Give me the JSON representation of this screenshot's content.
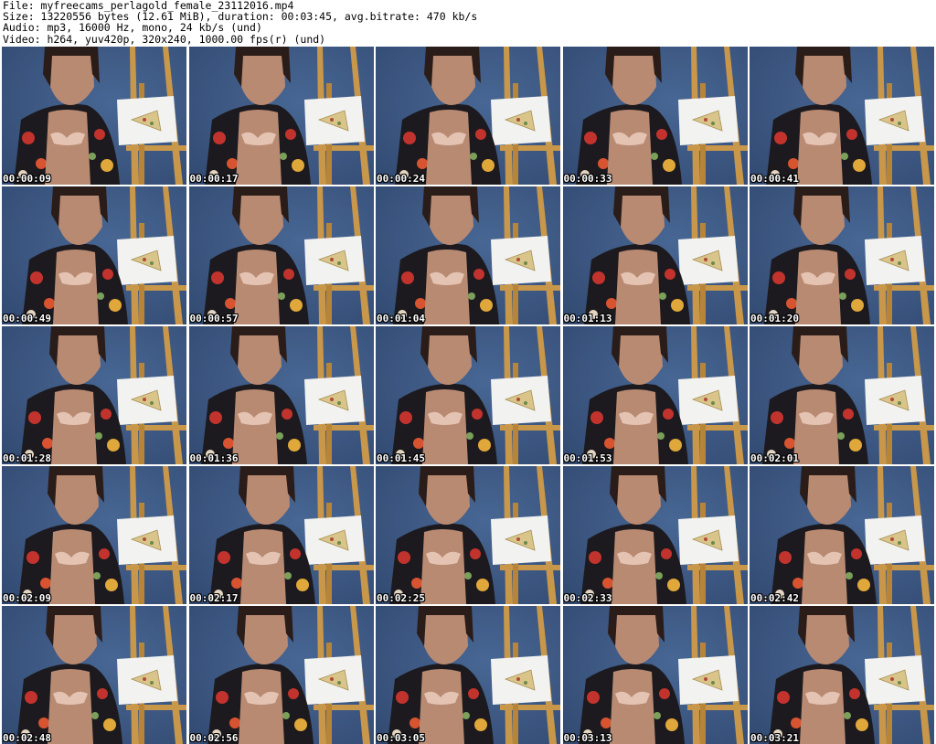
{
  "info": {
    "file": "File: myfreecams_perlagold_female_23112016.mp4",
    "size": "Size: 13220556 bytes (12.61 MiB), duration: 00:03:45, avg.bitrate: 470 kb/s",
    "audio": "Audio: mp3, 16000 Hz, mono, 24 kb/s (und)",
    "video": "Video: h264, yuv420p, 320x240, 1000.00 fps(r) (und)"
  },
  "colors": {
    "wall": "#3d5a86",
    "easel": "#c9974a",
    "canvas": "#f2f2f0",
    "robe": "#1c1a1e",
    "skin": "#b98a72",
    "hair": "#2a1c18",
    "flower_red": "#c2332e"
  },
  "frames": [
    {
      "timestamp": "00:00:09"
    },
    {
      "timestamp": "00:00:17"
    },
    {
      "timestamp": "00:00:24"
    },
    {
      "timestamp": "00:00:33"
    },
    {
      "timestamp": "00:00:41"
    },
    {
      "timestamp": "00:00:49"
    },
    {
      "timestamp": "00:00:57"
    },
    {
      "timestamp": "00:01:04"
    },
    {
      "timestamp": "00:01:13"
    },
    {
      "timestamp": "00:01:20"
    },
    {
      "timestamp": "00:01:28"
    },
    {
      "timestamp": "00:01:36"
    },
    {
      "timestamp": "00:01:45"
    },
    {
      "timestamp": "00:01:53"
    },
    {
      "timestamp": "00:02:01"
    },
    {
      "timestamp": "00:02:09"
    },
    {
      "timestamp": "00:02:17"
    },
    {
      "timestamp": "00:02:25"
    },
    {
      "timestamp": "00:02:33"
    },
    {
      "timestamp": "00:02:42"
    },
    {
      "timestamp": "00:02:48"
    },
    {
      "timestamp": "00:02:56"
    },
    {
      "timestamp": "00:03:05"
    },
    {
      "timestamp": "00:03:13"
    },
    {
      "timestamp": "00:03:21"
    }
  ]
}
